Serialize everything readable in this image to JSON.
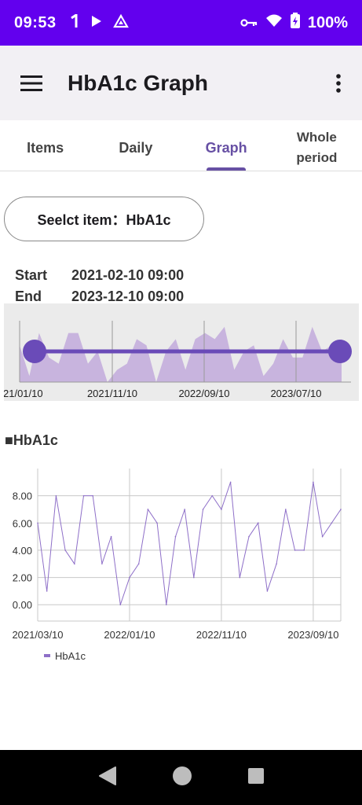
{
  "status_bar": {
    "time": "09:53",
    "battery": "100%"
  },
  "app_bar": {
    "title": "HbA1c Graph"
  },
  "tabs": [
    {
      "label": "Items",
      "active": false
    },
    {
      "label": "Daily",
      "active": false
    },
    {
      "label": "Graph",
      "active": true
    },
    {
      "label": "Whole\nperiod",
      "active": false
    }
  ],
  "select_button": {
    "label": "Seelct item：HbA1c"
  },
  "range": {
    "start_label": "Start",
    "start_value": "2021-02-10 09:00",
    "end_label": "End",
    "end_value": "2023-12-10 09:00"
  },
  "range_selector": {
    "tick_labels": [
      "21/01/10",
      "2021/11/10",
      "2022/09/10",
      "2023/07/10"
    ],
    "accent_color": "#6A4BB8",
    "fill_color": "#C8B4DE"
  },
  "section_title": "■HbA1c",
  "chart_data": {
    "type": "line",
    "title": "",
    "xlabel": "",
    "ylabel": "",
    "x_tick_labels": [
      "2021/03/10",
      "2022/01/10",
      "2022/11/10",
      "2023/09/10"
    ],
    "y_tick_labels": [
      "0.00",
      "2.00",
      "4.00",
      "6.00",
      "8.00"
    ],
    "ylim": [
      -1.2,
      10.0
    ],
    "grid": true,
    "legend_position": "bottom-left",
    "series": [
      {
        "name": "HbA1c",
        "color": "#8E6FC8",
        "values": [
          6,
          1,
          8,
          4,
          3,
          8,
          8,
          3,
          5,
          0,
          2,
          3,
          7,
          6,
          0,
          5,
          7,
          2,
          7,
          8,
          7,
          9,
          2,
          5,
          6,
          1,
          3,
          7,
          4,
          4,
          9,
          5,
          6,
          7
        ]
      }
    ]
  }
}
